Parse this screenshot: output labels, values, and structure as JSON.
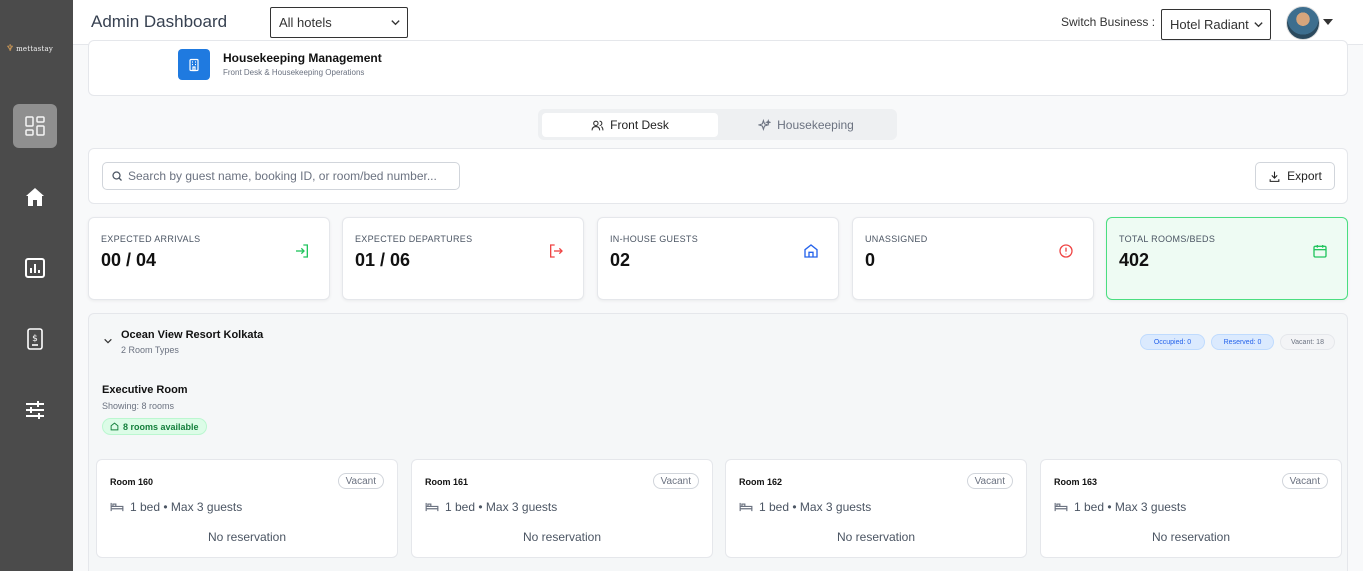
{
  "header": {
    "title": "Admin Dashboard",
    "hotel_filter": "All hotels",
    "switch_label": "Switch Business :",
    "business": "Hotel Radiant"
  },
  "page": {
    "title": "Housekeeping Management",
    "subtitle": "Front Desk & Housekeeping Operations"
  },
  "tabs": [
    {
      "label": "Front Desk",
      "active": true
    },
    {
      "label": "Housekeeping",
      "active": false
    }
  ],
  "search": {
    "placeholder": "Search by guest name, booking ID, or room/bed number..."
  },
  "export_label": "Export",
  "stats": [
    {
      "label": "EXPECTED ARRIVALS",
      "value": "00 / 04",
      "icon": "login-icon",
      "color": "#22c55e"
    },
    {
      "label": "EXPECTED DEPARTURES",
      "value": "01 / 06",
      "icon": "logout-icon",
      "color": "#ef4444"
    },
    {
      "label": "IN-HOUSE GUESTS",
      "value": "02",
      "icon": "home-icon",
      "color": "#2563eb"
    },
    {
      "label": "UNASSIGNED",
      "value": "0",
      "icon": "alert-circle-icon",
      "color": "#ef4444"
    },
    {
      "label": "TOTAL ROOMS/BEDS",
      "value": "402",
      "icon": "calendar-icon",
      "color": "#22c55e"
    }
  ],
  "property": {
    "name": "Ocean View Resort Kolkata",
    "subtitle": "2 Room Types",
    "badges": {
      "occupied": "Occupied: 0",
      "reserved": "Reserved: 0",
      "vacant": "Vacant: 18"
    },
    "room_type": {
      "name": "Executive Room",
      "showing": "Showing: 8 rooms",
      "available": "8 rooms available"
    },
    "rooms": [
      {
        "name": "Room 160",
        "status": "Vacant",
        "info": "1 bed • Max 3 guests",
        "reservation": "No reservation"
      },
      {
        "name": "Room 161",
        "status": "Vacant",
        "info": "1 bed • Max 3 guests",
        "reservation": "No reservation"
      },
      {
        "name": "Room 162",
        "status": "Vacant",
        "info": "1 bed • Max 3 guests",
        "reservation": "No reservation"
      },
      {
        "name": "Room 163",
        "status": "Vacant",
        "info": "1 bed • Max 3 guests",
        "reservation": "No reservation"
      }
    ]
  },
  "sidebar": {
    "logo_text": "mettastay",
    "items": [
      {
        "icon": "dashboard-icon",
        "active": true
      },
      {
        "icon": "home-icon",
        "active": false
      },
      {
        "icon": "chart-icon",
        "active": false
      },
      {
        "icon": "invoice-icon",
        "active": false
      },
      {
        "icon": "settings-sliders-icon",
        "active": false
      }
    ]
  }
}
